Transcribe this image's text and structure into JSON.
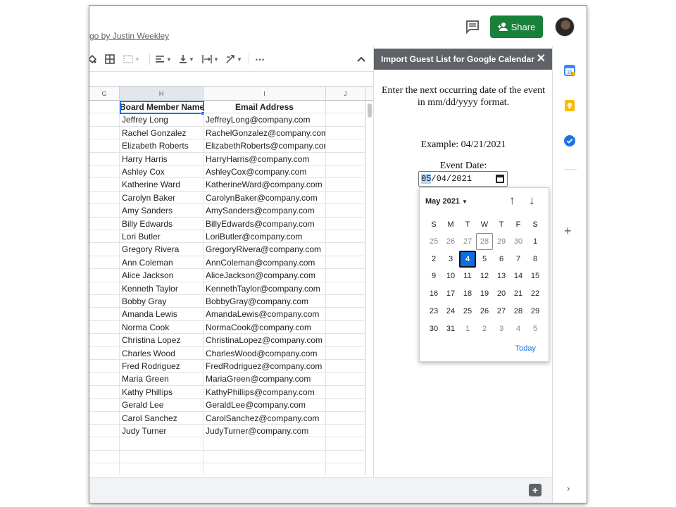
{
  "header": {
    "subtitle": "go by Justin Weekley",
    "share_label": "Share"
  },
  "toolbar": {
    "more_label": "⋯"
  },
  "columns": [
    "G",
    "H",
    "I",
    "J"
  ],
  "sheet": {
    "headers": [
      "Board Member Name",
      "Email Address"
    ],
    "rows": [
      [
        "Jeffrey Long",
        "JeffreyLong@company.com"
      ],
      [
        "Rachel Gonzalez",
        "RachelGonzalez@company.com"
      ],
      [
        "Elizabeth Roberts",
        "ElizabethRoberts@company.com"
      ],
      [
        "Harry Harris",
        "HarryHarris@company.com"
      ],
      [
        "Ashley Cox",
        "AshleyCox@company.com"
      ],
      [
        "Katherine Ward",
        "KatherineWard@company.com"
      ],
      [
        "Carolyn Baker",
        "CarolynBaker@company.com"
      ],
      [
        "Amy Sanders",
        "AmySanders@company.com"
      ],
      [
        "Billy Edwards",
        "BillyEdwards@company.com"
      ],
      [
        "Lori Butler",
        "LoriButler@company.com"
      ],
      [
        "Gregory Rivera",
        "GregoryRivera@company.com"
      ],
      [
        "Ann Coleman",
        "AnnColeman@company.com"
      ],
      [
        "Alice Jackson",
        "AliceJackson@company.com"
      ],
      [
        "Kenneth Taylor",
        "KennethTaylor@company.com"
      ],
      [
        "Bobby Gray",
        "BobbyGray@company.com"
      ],
      [
        "Amanda Lewis",
        "AmandaLewis@company.com"
      ],
      [
        "Norma Cook",
        "NormaCook@company.com"
      ],
      [
        "Christina Lopez",
        "ChristinaLopez@company.com"
      ],
      [
        "Charles Wood",
        "CharlesWood@company.com"
      ],
      [
        "Fred Rodriguez",
        "FredRodriguez@company.com"
      ],
      [
        "Maria Green",
        "MariaGreen@company.com"
      ],
      [
        "Kathy Phillips",
        "KathyPhillips@company.com"
      ],
      [
        "Gerald Lee",
        "GeraldLee@company.com"
      ],
      [
        "Carol Sanchez",
        "CarolSanchez@company.com"
      ],
      [
        "Judy Turner",
        "JudyTurner@company.com"
      ]
    ]
  },
  "panel": {
    "title": "Import Guest List for Google Calendar",
    "close_label": "✕",
    "instruction": "Enter the next occurring date of the event in mm/dd/yyyy format.",
    "example": "Example: 04/21/2021",
    "event_date_label": "Event Date:",
    "date_value_month": "05",
    "date_value_rest": "/04/2021"
  },
  "datepicker": {
    "month_label": "May 2021",
    "weekdays": [
      "S",
      "M",
      "T",
      "W",
      "T",
      "F",
      "S"
    ],
    "weeks": [
      [
        "25",
        "26",
        "27",
        "28",
        "29",
        "30",
        "1"
      ],
      [
        "2",
        "3",
        "4",
        "5",
        "6",
        "7",
        "8"
      ],
      [
        "9",
        "10",
        "11",
        "12",
        "13",
        "14",
        "15"
      ],
      [
        "16",
        "17",
        "18",
        "19",
        "20",
        "21",
        "22"
      ],
      [
        "23",
        "24",
        "25",
        "26",
        "27",
        "28",
        "29"
      ],
      [
        "30",
        "31",
        "1",
        "2",
        "3",
        "4",
        "5"
      ]
    ],
    "selected_day": "4",
    "today_label": "Today"
  },
  "colors": {
    "share": "#188038",
    "selected_day": "#0b6de0",
    "selection_border": "#1a73e8",
    "panel_header": "#5f6368"
  }
}
